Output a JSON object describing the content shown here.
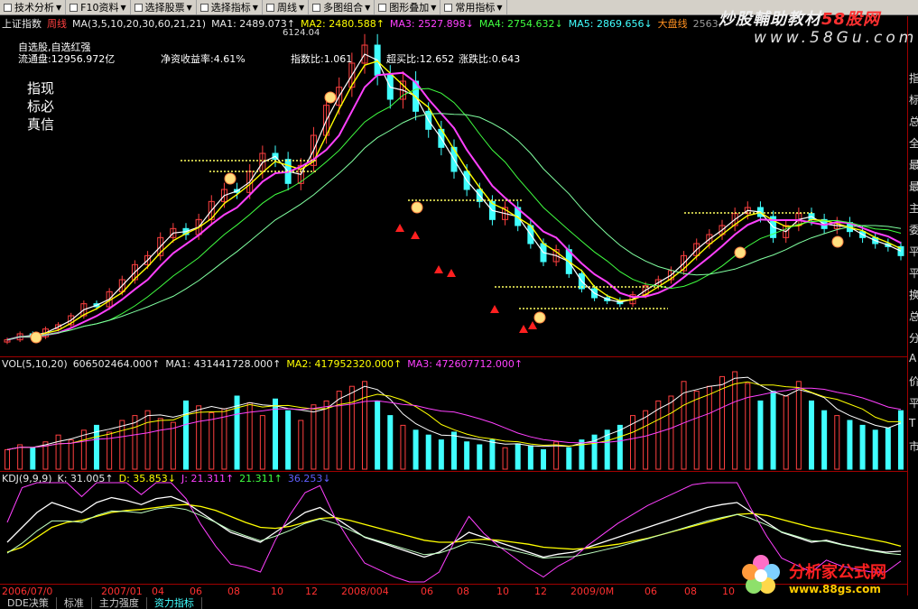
{
  "toolbar": {
    "items": [
      {
        "label": "技术分析",
        "icon": "chart-icon"
      },
      {
        "label": "F10资料",
        "icon": "doc-icon"
      },
      {
        "label": "选择股票",
        "icon": "stock-icon"
      },
      {
        "label": "选择指标",
        "icon": "indicator-icon"
      },
      {
        "label": "周线",
        "icon": "period-icon"
      },
      {
        "label": "多图组合",
        "icon": "multi-chart-icon"
      },
      {
        "label": "图形叠加",
        "icon": "overlay-icon"
      },
      {
        "label": "常用指标",
        "icon": "common-indicator-icon"
      }
    ]
  },
  "main_header": {
    "title": "上证指数",
    "period": "周线",
    "ma_params": "MA(3,5,10,20,30,60,21,21)",
    "ma1": "MA1: 2489.073↑",
    "ma2": "MA2: 2480.588↑",
    "ma3": "MA3: 2527.898↓",
    "ma4": "MA4: 2754.632↓",
    "ma5": "MA5: 2869.656↓",
    "dapan": "大盘线",
    "dapan_val": "2563."
  },
  "info": {
    "line1": "自选股,自选红强",
    "line2": "流通盘:12956.972亿",
    "roe": "净资收益率:4.61%",
    "peak": "6124.04",
    "zhishubi": "指数比:1.061",
    "chaomaibi": "超买比:12.652",
    "zhangdiebi": "涨跌比:0.643"
  },
  "slogan": "指现标必真信",
  "watermark": {
    "text": "炒股輔助教材",
    "brand": "58股网",
    "url": "www.58Gu.com"
  },
  "vol_header": {
    "name": "VOL(5,10,20)",
    "val": "606502464.000↑",
    "ma1": "MA1: 431441728.000↑",
    "ma2": "MA2: 417952320.000↑",
    "ma3": "MA3: 472607712.000↑"
  },
  "kdj_header": {
    "name": "KDJ(9,9,9)",
    "k": "K: 31.005↑",
    "d": "D: 35.853↓",
    "j": "J: 21.311↑",
    "k2": "21.311↑",
    "d2": "36.253↓"
  },
  "right_axis_chars": [
    "指",
    "标",
    "总",
    "全",
    "最",
    "最",
    "主",
    "委",
    "平",
    "平",
    "换",
    "总",
    "分",
    "A",
    "价",
    "平",
    "T",
    "市"
  ],
  "xaxis": {
    "labels": [
      "2006/07/0",
      "2007/01",
      "04",
      "06",
      "08",
      "10",
      "12",
      "2008/004",
      "06",
      "08",
      "10",
      "12",
      "2009/0M",
      "06",
      "08",
      "10"
    ]
  },
  "bottom_tabs": [
    "DDE决策",
    "标准",
    "主力强度",
    "资力指标"
  ],
  "logo": {
    "cn": "分析家公式网",
    "url": "www.88gs.com"
  },
  "colors": {
    "up": "#ff4040",
    "down": "#40ffff",
    "ma_white": "#ffffff",
    "ma_yellow": "#ffff00",
    "ma_magenta": "#ff40ff",
    "ma_green": "#40ff40",
    "ma_lime": "#80ffa0",
    "axis": "#a00000"
  },
  "chart_data": {
    "type": "line",
    "price": [
      1200,
      1300,
      1250,
      1380,
      1450,
      1600,
      1800,
      1750,
      2000,
      2200,
      2450,
      2600,
      2900,
      3050,
      2950,
      3200,
      3500,
      3700,
      3650,
      4000,
      4300,
      4200,
      3800,
      4100,
      4600,
      5100,
      5400,
      5800,
      6100,
      5600,
      5200,
      5500,
      5000,
      4700,
      4400,
      4000,
      3700,
      3500,
      3200,
      3400,
      3100,
      2800,
      2500,
      2700,
      2300,
      2050,
      1900,
      1850,
      1800,
      1950,
      2100,
      2200,
      2350,
      2600,
      2800,
      2950,
      3100,
      3300,
      3400,
      3250,
      2900,
      3100,
      3300,
      3200,
      3050,
      3150,
      3000,
      2900,
      2800,
      2750,
      2600
    ],
    "volume": [
      0.2,
      0.25,
      0.22,
      0.28,
      0.35,
      0.3,
      0.4,
      0.45,
      0.38,
      0.5,
      0.55,
      0.6,
      0.52,
      0.48,
      0.7,
      0.65,
      0.58,
      0.62,
      0.75,
      0.68,
      0.55,
      0.72,
      0.6,
      0.5,
      0.66,
      0.7,
      0.8,
      0.85,
      0.9,
      0.7,
      0.55,
      0.45,
      0.4,
      0.35,
      0.3,
      0.38,
      0.28,
      0.25,
      0.3,
      0.22,
      0.26,
      0.24,
      0.2,
      0.28,
      0.22,
      0.3,
      0.35,
      0.4,
      0.45,
      0.55,
      0.6,
      0.7,
      0.75,
      0.9,
      0.8,
      0.85,
      0.95,
      1.0,
      0.88,
      0.7,
      0.8,
      0.75,
      0.9,
      0.7,
      0.6,
      0.55,
      0.5,
      0.45,
      0.4,
      0.42,
      0.6
    ],
    "k": [
      40,
      55,
      70,
      80,
      75,
      70,
      80,
      85,
      82,
      78,
      84,
      86,
      80,
      70,
      60,
      50,
      45,
      40,
      50,
      60,
      70,
      75,
      65,
      55,
      45,
      40,
      35,
      30,
      25,
      30,
      40,
      50,
      45,
      40,
      35,
      30,
      25,
      28,
      30,
      35,
      40,
      45,
      50,
      55,
      60,
      65,
      70,
      75,
      78,
      80,
      70,
      60,
      50,
      45,
      40,
      42,
      38,
      35,
      32,
      30,
      31
    ],
    "d": [
      30,
      35,
      45,
      55,
      60,
      62,
      66,
      70,
      72,
      73,
      75,
      77,
      78,
      76,
      72,
      66,
      60,
      55,
      54,
      56,
      60,
      64,
      65,
      62,
      58,
      54,
      50,
      46,
      42,
      40,
      40,
      42,
      43,
      42,
      40,
      38,
      35,
      34,
      33,
      34,
      36,
      38,
      41,
      44,
      48,
      52,
      56,
      60,
      64,
      68,
      69,
      67,
      63,
      59,
      55,
      52,
      49,
      46,
      43,
      40,
      36
    ]
  }
}
